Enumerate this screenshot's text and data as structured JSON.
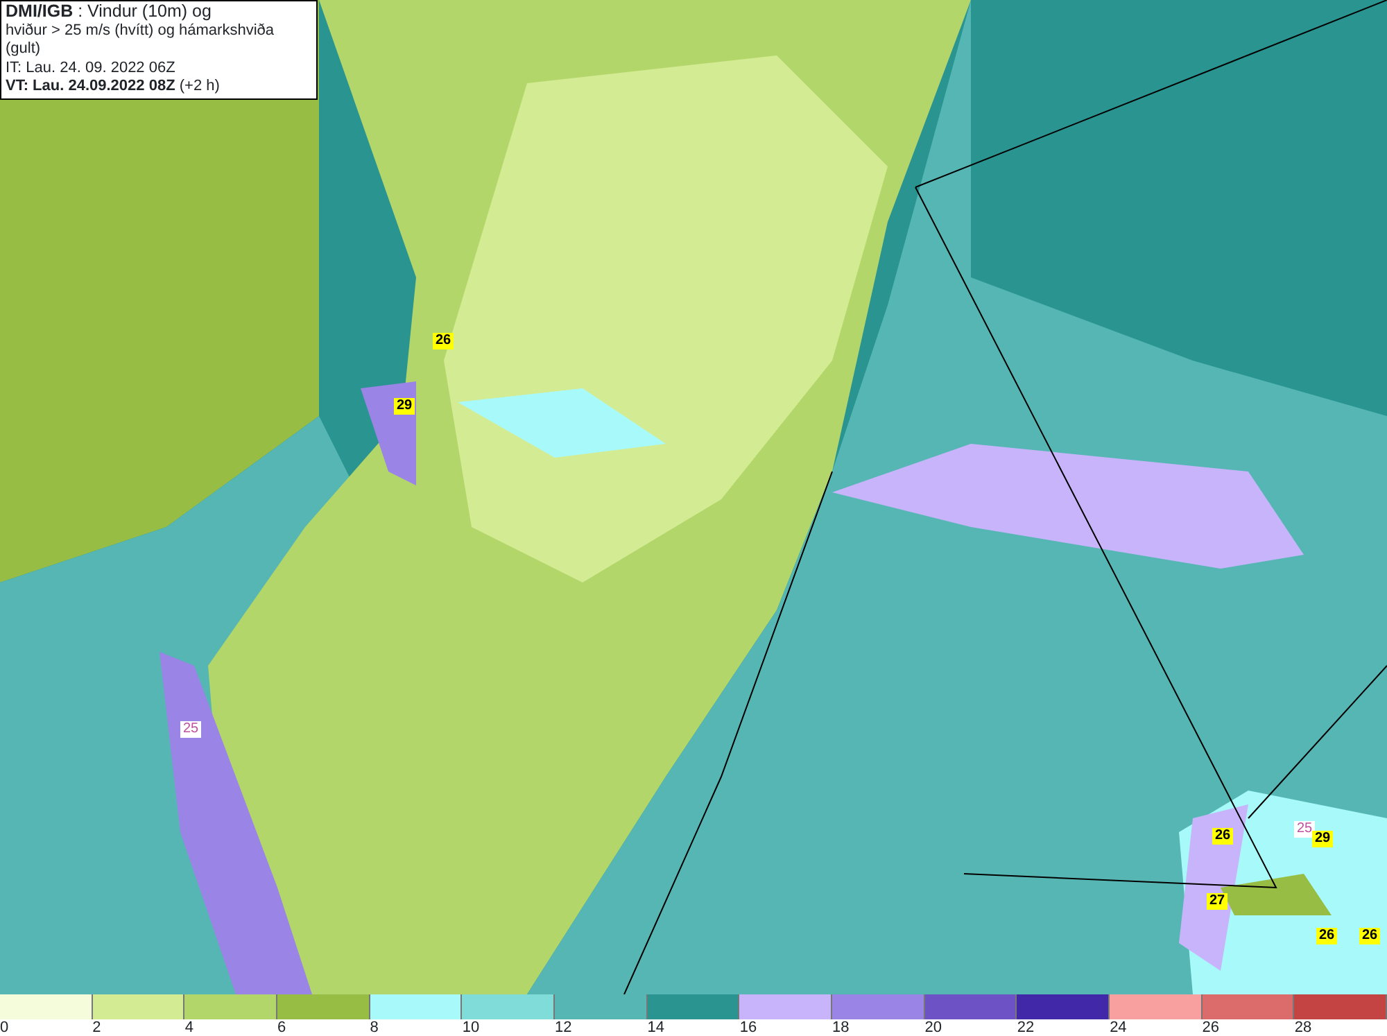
{
  "title_box": {
    "lines": [
      "**DMI/IGB** : Vindur (10m) og",
      "hviður > 25 m/s (hvítt) og hámarkshviða (gult)",
      "IT: Lau. 24. 09. 2022 06Z",
      "**VT: Lau. 24.09.2022 08Z** (+2 h)"
    ]
  },
  "gust_labels": [
    {
      "text": "26",
      "kind": "max"
    },
    {
      "text": "29",
      "kind": "max"
    },
    {
      "text": "25",
      "kind": "gust"
    },
    {
      "text": "26",
      "kind": "max"
    },
    {
      "text": "25",
      "kind": "gust"
    },
    {
      "text": "29",
      "kind": "max"
    },
    {
      "text": "27",
      "kind": "max"
    },
    {
      "text": "26",
      "kind": "max"
    },
    {
      "text": "26",
      "kind": "max"
    }
  ],
  "legend": [
    {
      "label": "0",
      "color": "#f5fcdc"
    },
    {
      "label": "2",
      "color": "#d3ec94"
    },
    {
      "label": "4",
      "color": "#b3d66a"
    },
    {
      "label": "6",
      "color": "#98bd45"
    },
    {
      "label": "8",
      "color": "#a8fafa"
    },
    {
      "label": "10",
      "color": "#80dcd8"
    },
    {
      "label": "12",
      "color": "#55b6b4"
    },
    {
      "label": "14",
      "color": "#2a9490"
    },
    {
      "label": "16",
      "color": "#c8b4fa"
    },
    {
      "label": "18",
      "color": "#9a84e6"
    },
    {
      "label": "20",
      "color": "#6c52c4"
    },
    {
      "label": "22",
      "color": "#4028a8"
    },
    {
      "label": "24",
      "color": "#f8a0a0"
    },
    {
      "label": "26",
      "color": "#dc6c6c"
    },
    {
      "label": "28",
      "color": "#c44444"
    }
  ]
}
